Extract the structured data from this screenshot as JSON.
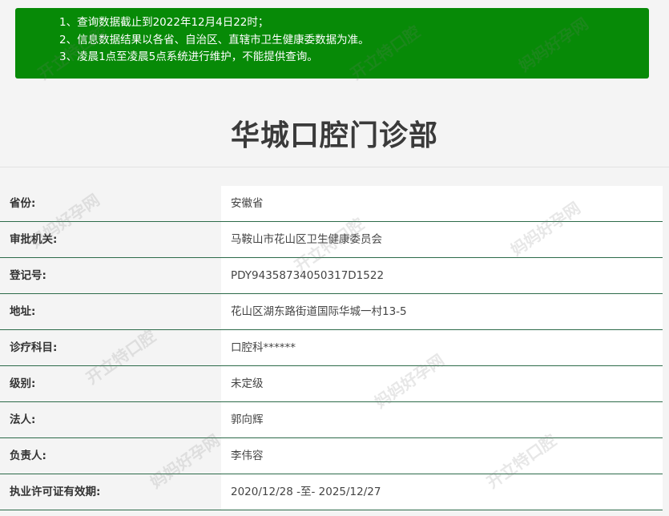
{
  "notice": {
    "lines": [
      "1、查询数据截止到2022年12月4日22时；",
      "2、信息数据结果以各省、自治区、直辖市卫生健康委数据为准。",
      "3、凌晨1点至凌晨5点系统进行维护，不能提供查询。"
    ]
  },
  "title": "华城口腔门诊部",
  "rows": [
    {
      "label": "省份:",
      "value": "安徽省"
    },
    {
      "label": "审批机关:",
      "value": "马鞍山市花山区卫生健康委员会"
    },
    {
      "label": "登记号:",
      "value": "PDY94358734050317D1522"
    },
    {
      "label": "地址:",
      "value": "花山区湖东路街道国际华城一村13-5"
    },
    {
      "label": "诊疗科目:",
      "value": "口腔科******"
    },
    {
      "label": "级别:",
      "value": "未定级"
    },
    {
      "label": "法人:",
      "value": "郭向辉"
    },
    {
      "label": "负责人:",
      "value": "李伟容"
    },
    {
      "label": "执业许可证有效期:",
      "value": "2020/12/28 -至- 2025/12/27"
    }
  ],
  "watermarks": [
    "开立特口腔",
    "妈妈好孕网"
  ],
  "colors": {
    "notice_bg": "#078a07",
    "row_border": "#2d6b4a"
  }
}
